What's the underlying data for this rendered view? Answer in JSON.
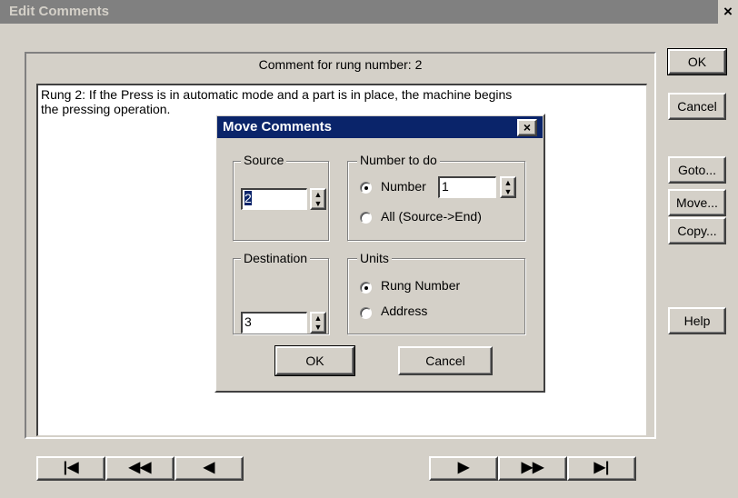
{
  "window": {
    "title": "Edit Comments",
    "close": "×"
  },
  "main": {
    "caption": "Comment for rung number: 2",
    "comment_text": "Rung 2: If the Press is in automatic mode and a part is in place, the machine begins\nthe pressing operation."
  },
  "side_buttons": {
    "ok": "OK",
    "cancel": "Cancel",
    "goto": "Goto...",
    "move": "Move...",
    "copy": "Copy...",
    "help": "Help"
  },
  "nav_buttons": {
    "first": "|◀",
    "prev_page": "◀◀",
    "prev": "◀",
    "next": "▶",
    "next_page": "▶▶",
    "last": "▶|"
  },
  "dialog": {
    "title": "Move Comments",
    "close": "×",
    "source": {
      "label": "Source",
      "value": "2"
    },
    "destination": {
      "label": "Destination",
      "value": "3"
    },
    "number_to_do": {
      "label": "Number to do",
      "option_number": "Number",
      "number_value": "1",
      "option_all": "All (Source->End)",
      "selected": "Number"
    },
    "units": {
      "label": "Units",
      "option_rung": "Rung Number",
      "option_address": "Address",
      "selected": "Rung Number"
    },
    "ok": "OK",
    "cancel": "Cancel"
  }
}
